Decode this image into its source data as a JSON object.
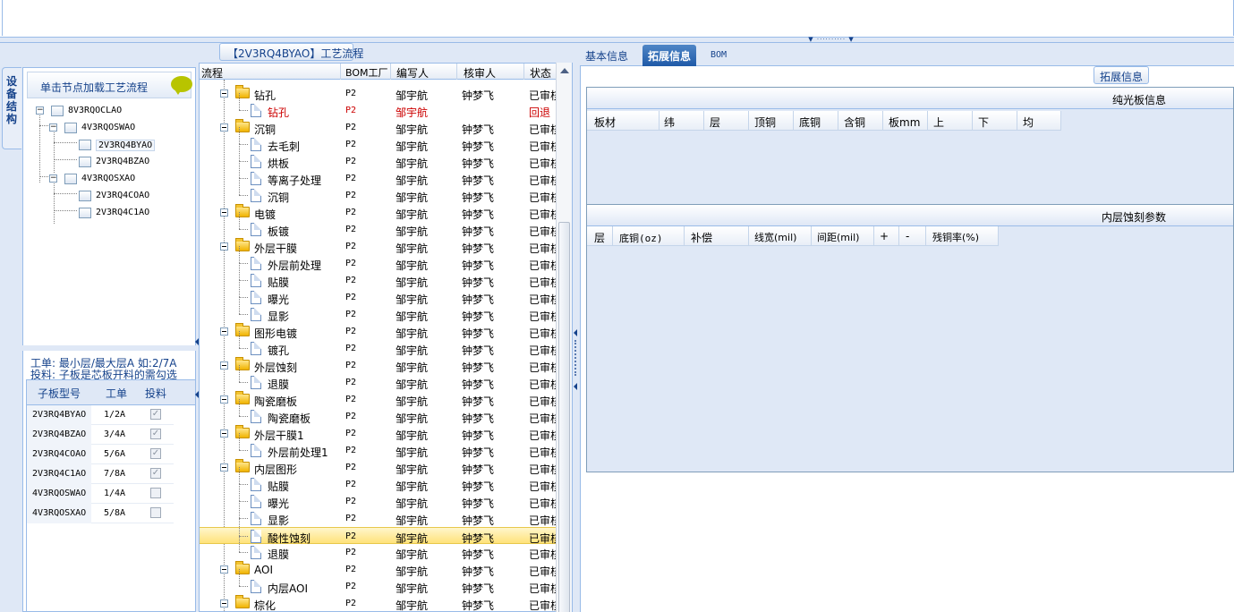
{
  "left_tab_label": "设备结构",
  "left_header": "单击节点加载工艺流程",
  "tree": [
    {
      "label": "8V3RQOCLAO"
    },
    {
      "label": "4V3RQOSWAO"
    },
    {
      "label": "2V3RQ4BYAO"
    },
    {
      "label": "2V3RQ4BZAO"
    },
    {
      "label": "4V3RQOSXAO"
    },
    {
      "label": "2V3RQ4COAO"
    },
    {
      "label": "2V3RQ4C1AO"
    }
  ],
  "info_line1": "工单: 最小层/最大层A 如:2/7A",
  "info_line2": "投料: 子板是芯板开料的需勾选",
  "sub_grid": {
    "headers": [
      "子板型号",
      "工单",
      "投料"
    ],
    "rows": [
      {
        "model": "2V3RQ4BYAO",
        "order": "1/2A",
        "checked": true
      },
      {
        "model": "2V3RQ4BZAO",
        "order": "3/4A",
        "checked": true
      },
      {
        "model": "2V3RQ4COAO",
        "order": "5/6A",
        "checked": true
      },
      {
        "model": "2V3RQ4C1AO",
        "order": "7/8A",
        "checked": true
      },
      {
        "model": "4V3RQOSWAO",
        "order": "1/4A",
        "checked": false
      },
      {
        "model": "4V3RQOSXAO",
        "order": "5/8A",
        "checked": false
      }
    ]
  },
  "mid_title": "【2V3RQ4BYAO】工艺流程",
  "mid_headers": {
    "flow": "流程",
    "bom": "BOM工厂",
    "author": "编写人",
    "reviewer": "核审人",
    "status": "状态"
  },
  "flow_rows": [
    {
      "type": "folder",
      "name": "钻孔",
      "bom": "P2",
      "author": "邹宇航",
      "reviewer": "钟梦飞",
      "status": "已审核"
    },
    {
      "type": "doc",
      "name": "钻孔",
      "bom": "P2",
      "author": "邹宇航",
      "reviewer": "",
      "status": "回退",
      "red": true
    },
    {
      "type": "folder",
      "name": "沉铜",
      "bom": "P2",
      "author": "邹宇航",
      "reviewer": "钟梦飞",
      "status": "已审核"
    },
    {
      "type": "doc",
      "name": "去毛刺",
      "bom": "P2",
      "author": "邹宇航",
      "reviewer": "钟梦飞",
      "status": "已审核"
    },
    {
      "type": "doc",
      "name": "烘板",
      "bom": "P2",
      "author": "邹宇航",
      "reviewer": "钟梦飞",
      "status": "已审核"
    },
    {
      "type": "doc",
      "name": "等离子处理",
      "bom": "P2",
      "author": "邹宇航",
      "reviewer": "钟梦飞",
      "status": "已审核"
    },
    {
      "type": "doc",
      "name": "沉铜",
      "bom": "P2",
      "author": "邹宇航",
      "reviewer": "钟梦飞",
      "status": "已审核"
    },
    {
      "type": "folder",
      "name": "电镀",
      "bom": "P2",
      "author": "邹宇航",
      "reviewer": "钟梦飞",
      "status": "已审核"
    },
    {
      "type": "doc",
      "name": "板镀",
      "bom": "P2",
      "author": "邹宇航",
      "reviewer": "钟梦飞",
      "status": "已审核"
    },
    {
      "type": "folder",
      "name": "外层干膜",
      "bom": "P2",
      "author": "邹宇航",
      "reviewer": "钟梦飞",
      "status": "已审核"
    },
    {
      "type": "doc",
      "name": "外层前处理",
      "bom": "P2",
      "author": "邹宇航",
      "reviewer": "钟梦飞",
      "status": "已审核"
    },
    {
      "type": "doc",
      "name": "贴膜",
      "bom": "P2",
      "author": "邹宇航",
      "reviewer": "钟梦飞",
      "status": "已审核"
    },
    {
      "type": "doc",
      "name": "曝光",
      "bom": "P2",
      "author": "邹宇航",
      "reviewer": "钟梦飞",
      "status": "已审核"
    },
    {
      "type": "doc",
      "name": "显影",
      "bom": "P2",
      "author": "邹宇航",
      "reviewer": "钟梦飞",
      "status": "已审核"
    },
    {
      "type": "folder",
      "name": "图形电镀",
      "bom": "P2",
      "author": "邹宇航",
      "reviewer": "钟梦飞",
      "status": "已审核"
    },
    {
      "type": "doc",
      "name": "镀孔",
      "bom": "P2",
      "author": "邹宇航",
      "reviewer": "钟梦飞",
      "status": "已审核"
    },
    {
      "type": "folder",
      "name": "外层蚀刻",
      "bom": "P2",
      "author": "邹宇航",
      "reviewer": "钟梦飞",
      "status": "已审核"
    },
    {
      "type": "doc",
      "name": "退膜",
      "bom": "P2",
      "author": "邹宇航",
      "reviewer": "钟梦飞",
      "status": "已审核"
    },
    {
      "type": "folder",
      "name": "陶瓷磨板",
      "bom": "P2",
      "author": "邹宇航",
      "reviewer": "钟梦飞",
      "status": "已审核"
    },
    {
      "type": "doc",
      "name": "陶瓷磨板",
      "bom": "P2",
      "author": "邹宇航",
      "reviewer": "钟梦飞",
      "status": "已审核"
    },
    {
      "type": "folder",
      "name": "外层干膜1",
      "bom": "P2",
      "author": "邹宇航",
      "reviewer": "钟梦飞",
      "status": "已审核"
    },
    {
      "type": "doc",
      "name": "外层前处理1",
      "bom": "P2",
      "author": "邹宇航",
      "reviewer": "钟梦飞",
      "status": "已审核"
    },
    {
      "type": "folder",
      "name": "内层图形",
      "bom": "P2",
      "author": "邹宇航",
      "reviewer": "钟梦飞",
      "status": "已审核"
    },
    {
      "type": "doc",
      "name": "贴膜",
      "bom": "P2",
      "author": "邹宇航",
      "reviewer": "钟梦飞",
      "status": "已审核"
    },
    {
      "type": "doc",
      "name": "曝光",
      "bom": "P2",
      "author": "邹宇航",
      "reviewer": "钟梦飞",
      "status": "已审核"
    },
    {
      "type": "doc",
      "name": "显影",
      "bom": "P2",
      "author": "邹宇航",
      "reviewer": "钟梦飞",
      "status": "已审核"
    },
    {
      "type": "doc",
      "name": "酸性蚀刻",
      "bom": "P2",
      "author": "邹宇航",
      "reviewer": "钟梦飞",
      "status": "已审核",
      "selected": true
    },
    {
      "type": "doc",
      "name": "退膜",
      "bom": "P2",
      "author": "邹宇航",
      "reviewer": "钟梦飞",
      "status": "已审核"
    },
    {
      "type": "folder",
      "name": "AOI",
      "bom": "P2",
      "author": "邹宇航",
      "reviewer": "钟梦飞",
      "status": "已审核"
    },
    {
      "type": "doc",
      "name": "内层AOI",
      "bom": "P2",
      "author": "邹宇航",
      "reviewer": "钟梦飞",
      "status": "已审核"
    },
    {
      "type": "folder",
      "name": "棕化",
      "bom": "P2",
      "author": "邹宇航",
      "reviewer": "钟梦飞",
      "status": "已审核"
    }
  ],
  "right_tabs": [
    "基本信息",
    "拓展信息",
    "BOM"
  ],
  "ext_label": "拓展信息",
  "section1": {
    "title": "纯光板信息",
    "headers": [
      "板材",
      "纬",
      "层",
      "顶铜",
      "底铜",
      "含铜",
      "板mm",
      "上",
      "下",
      "均"
    ]
  },
  "section2": {
    "title": "内层蚀刻参数",
    "headers": [
      "层",
      "底铜(oz)",
      "补偿",
      "线宽(mil)",
      "间距(mil)",
      "+",
      "-",
      "残铜率(%)"
    ]
  },
  "colors": {
    "accent": "#15428b",
    "border": "#99bbe8",
    "panel_bg": "#dfe8f6",
    "active_tab": "#1f5aa8",
    "selected_row": "#ffe27a",
    "reject_red": "#cc0000"
  }
}
